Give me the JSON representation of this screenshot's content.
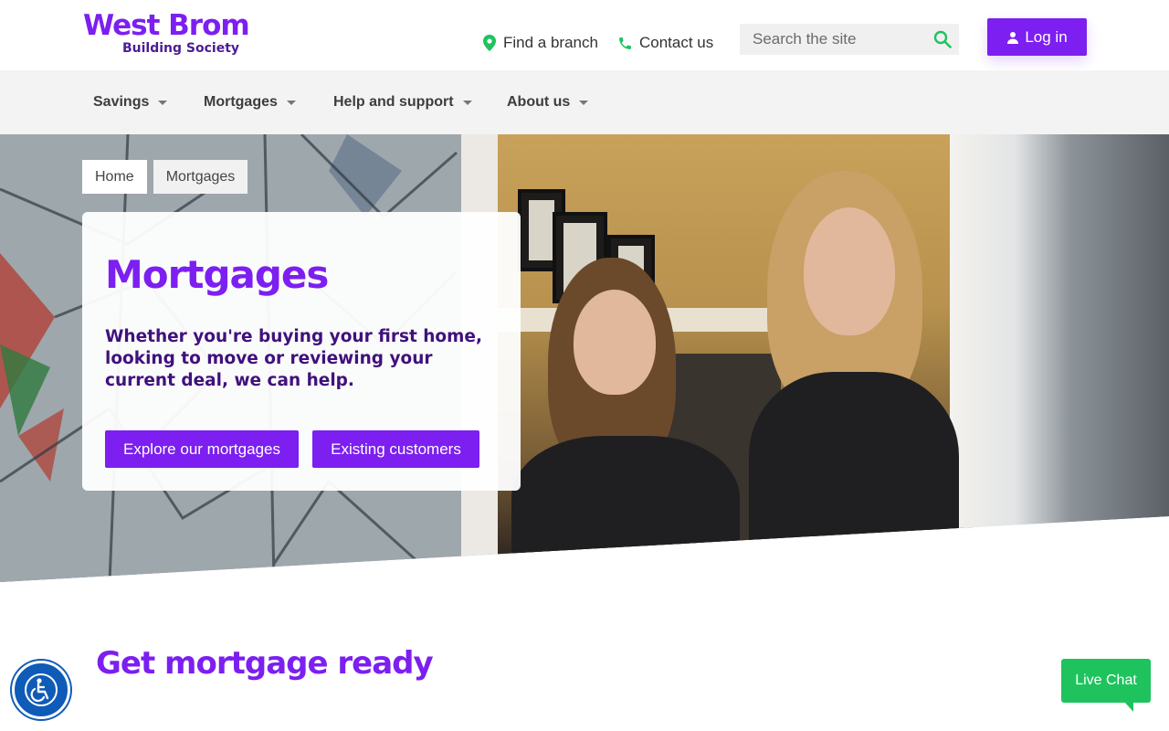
{
  "brand": {
    "name": "West Brom",
    "subtitle": "Building Society",
    "color": "#7c1ff0"
  },
  "header": {
    "find_branch": "Find a branch",
    "contact": "Contact us",
    "search_placeholder": "Search the site",
    "login": "Log in"
  },
  "nav": {
    "items": [
      {
        "label": "Savings",
        "icon": "caret-down-icon"
      },
      {
        "label": "Mortgages",
        "icon": "caret-down-icon"
      },
      {
        "label": "Help and support",
        "icon": "caret-down-icon"
      },
      {
        "label": "About us",
        "icon": "caret-down-icon"
      }
    ]
  },
  "breadcrumb": [
    "Home",
    "Mortgages"
  ],
  "hero": {
    "title": "Mortgages",
    "text": "Whether you're buying your first home, looking to move or reviewing your current deal, we can help.",
    "primary_button": "Explore our mortgages",
    "secondary_button": "Existing customers"
  },
  "section": {
    "title": "Get mortgage ready"
  },
  "widgets": {
    "accessibility_icon": "accessibility-icon",
    "live_chat": "Live Chat",
    "chat_color": "#1ec35e"
  }
}
